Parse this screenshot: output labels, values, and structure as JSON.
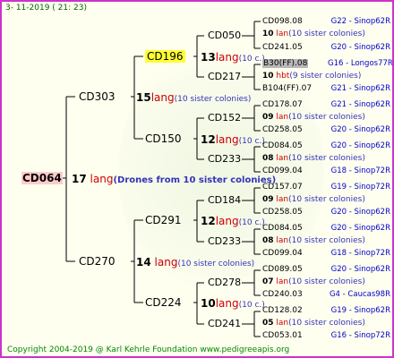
{
  "header": {
    "date": "3-  11-2019  (  21:  23)"
  },
  "footer": {
    "copyright": "Copyright 2004-2019 @ Karl Kehrle Foundation    www.pedigreeapis.org"
  },
  "root": {
    "name": "CD064",
    "count": "17",
    "lang": "lang",
    "note": "(Drones from 10 sister colonies)"
  },
  "gen1": [
    {
      "name": "CD303",
      "count": "15",
      "lang": "lang",
      "note": "(10 sister colonies)"
    },
    {
      "name": "CD270",
      "count": "14",
      "lang": "lang",
      "note": "(10 sister colonies)"
    }
  ],
  "gen2": [
    {
      "name": "CD196",
      "count": "13",
      "lang": "lang",
      "note": "(10 c.)"
    },
    {
      "name": "CD150",
      "count": "12",
      "lang": "lang",
      "note": "(10 c.)"
    },
    {
      "name": "CD291",
      "count": "12",
      "lang": "lang",
      "note": "(10 c.)"
    },
    {
      "name": "CD224",
      "count": "10",
      "lang": "lang",
      "note": "(10 c.)"
    }
  ],
  "gen3": [
    "CD050",
    "CD217",
    "CD152",
    "CD233",
    "CD184",
    "CD233",
    "CD278",
    "CD241"
  ],
  "gen4": [
    {
      "queen": "CD098.08",
      "source": "G22 - Sinop62R",
      "count": "10",
      "lang": "lan",
      "note": "(10 sister colonies)",
      "drone": "CD241.05",
      "dsource": "G20 - Sinop62R"
    },
    {
      "queen": "B30(FF).08",
      "source": "G16 - Longos77R",
      "count": "10",
      "lang": "hbt",
      "note": "(9 sister colonies)",
      "drone": "B104(FF).07",
      "dsource": "G21 - Sinop62R"
    },
    {
      "queen": "CD178.07",
      "source": "G21 - Sinop62R",
      "count": "09",
      "lang": "lan",
      "note": "(10 sister colonies)",
      "drone": "CD258.05",
      "dsource": "G20 - Sinop62R"
    },
    {
      "queen": "CD084.05",
      "source": "G20 - Sinop62R",
      "count": "08",
      "lang": "lan",
      "note": "(10 sister colonies)",
      "drone": "CD099.04",
      "dsource": "G18 - Sinop72R"
    },
    {
      "queen": "CD157.07",
      "source": "G19 - Sinop72R",
      "count": "09",
      "lang": "lan",
      "note": "(10 sister colonies)",
      "drone": "CD258.05",
      "dsource": "G20 - Sinop62R"
    },
    {
      "queen": "CD084.05",
      "source": "G20 - Sinop62R",
      "count": "08",
      "lang": "lan",
      "note": "(10 sister colonies)",
      "drone": "CD099.04",
      "dsource": "G18 - Sinop72R"
    },
    {
      "queen": "CD089.05",
      "source": "G20 - Sinop62R",
      "count": "07",
      "lang": "lan",
      "note": "(10 sister colonies)",
      "drone": "CD240.03",
      "dsource": "G4 - Caucas98R"
    },
    {
      "queen": "CD128.02",
      "source": "G19 - Sinop62R",
      "count": "05",
      "lang": "lan",
      "note": "(10 sister colonies)",
      "drone": "CD053.01",
      "dsource": "G16 - Sinop72R"
    }
  ],
  "colors": {
    "frame": "#cc33cc",
    "lang": "#cc0000",
    "note": "#3333bb",
    "source": "#0000cc",
    "root_bg": "#ffcccc",
    "highlight": "#ffff33"
  }
}
